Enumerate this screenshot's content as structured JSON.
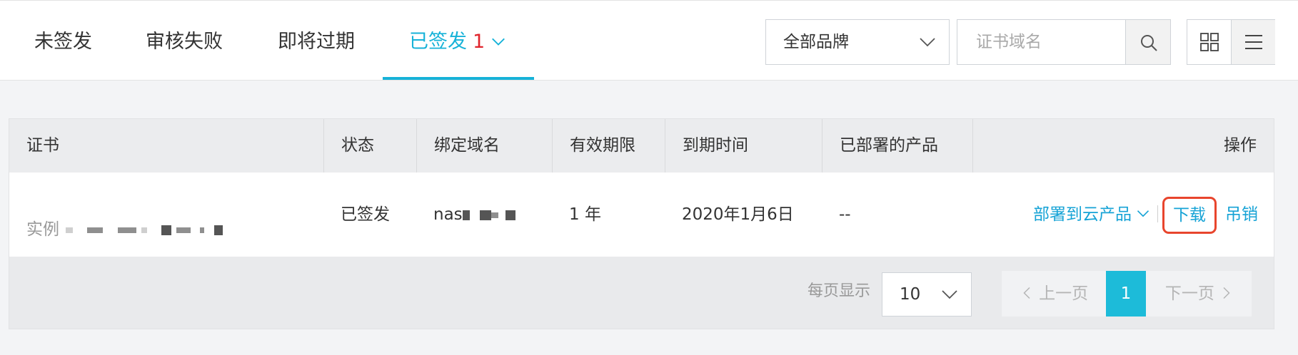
{
  "tabs": [
    {
      "label": "未签发"
    },
    {
      "label": "审核失败"
    },
    {
      "label": "即将过期"
    },
    {
      "label": "已签发",
      "count": "1"
    }
  ],
  "filters": {
    "brand_selected": "全部品牌",
    "search_placeholder": "证书域名"
  },
  "table": {
    "headers": [
      "证书",
      "状态",
      "绑定域名",
      "有效期限",
      "到期时间",
      "已部署的产品",
      "操作"
    ],
    "rows": [
      {
        "cert_name": "实例",
        "status": "已签发",
        "domain": "nas",
        "validity": "1 年",
        "expiry": "2020年1月6日",
        "deployed": "--",
        "actions": {
          "deploy": "部署到云产品",
          "download": "下载",
          "revoke": "吊销"
        }
      }
    ]
  },
  "pagination": {
    "per_page_label": "每页显示",
    "per_page_value": "10",
    "prev": "上一页",
    "current": "1",
    "next": "下一页"
  },
  "colors": {
    "accent": "#16b2d8",
    "link": "#16a3d6",
    "count_red": "#e0242c",
    "highlight_box": "#e8452d"
  }
}
